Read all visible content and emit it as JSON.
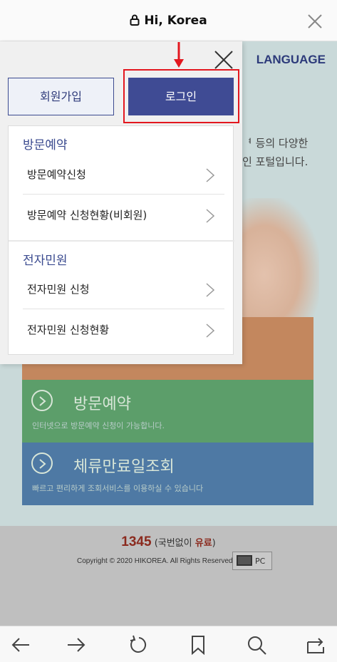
{
  "browser": {
    "title": "Hi, Korea",
    "lock_icon": "lock-icon",
    "close_icon": "close-icon"
  },
  "background_page": {
    "language_label": "LANGUAGE",
    "intro_line1": "ᅧ 등의 다양한",
    "intro_line2": "인 포털입니다.",
    "tiles": [
      {
        "title": "",
        "desc": "",
        "color": "#c3875e"
      },
      {
        "title": "방문예약",
        "desc": "인터넷으로 방문예약 신청이 가능합니다.",
        "color": "#5c9e6a"
      },
      {
        "title": "체류만료일조회",
        "desc": "빠르고 편리하게 조회서비스를 이용하실 수 있습니다",
        "color": "#4e79a4"
      }
    ],
    "footer": {
      "phone": "1345",
      "phone_note_prefix": "(국번없이 ",
      "phone_note_paid": "유료",
      "phone_note_suffix": ")",
      "copyright": "Copyright © 2020 HIKOREA. All Rights Reserved.",
      "pc_label": "PC"
    }
  },
  "menu_panel": {
    "join_label": "회원가입",
    "login_label": "로그인",
    "sections": [
      {
        "title": "방문예약",
        "items": [
          "방문예약신청",
          "방문예약 신청현황(비회원)"
        ]
      },
      {
        "title": "전자민원",
        "items": [
          "전자민원 신청",
          "전자민원 신청현황"
        ]
      }
    ]
  },
  "colors": {
    "accent": "#3f4b94",
    "highlight": "#e3171f"
  },
  "toolbar": {
    "icons": [
      "back-icon",
      "forward-icon",
      "reload-icon",
      "bookmark-icon",
      "search-icon",
      "share-icon"
    ]
  }
}
